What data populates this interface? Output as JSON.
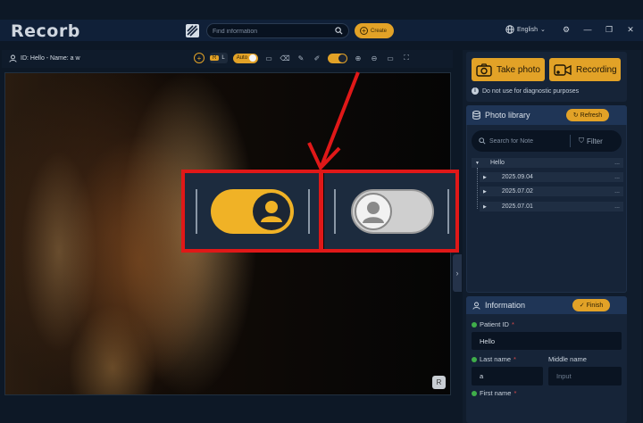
{
  "app": {
    "logo": "Recorb"
  },
  "titlebar": {
    "search_placeholder": "Find information",
    "create_label": "Create",
    "language": "English"
  },
  "viewer": {
    "patient_label": "ID: Hello - Name: a w",
    "seg_r": "R",
    "seg_l": "L",
    "auto_label": "Auto",
    "corner_badge": "R"
  },
  "capture": {
    "photo_label": "Take photo",
    "record_label": "Recording",
    "warning": "Do not use for diagnostic purposes"
  },
  "library": {
    "title": "Photo library",
    "refresh_label": "Refresh",
    "search_placeholder": "Search for Note",
    "filter_label": "Filter",
    "tree": [
      {
        "label": "Hello",
        "more": "..."
      },
      {
        "label": "2025.09.04",
        "more": "..."
      },
      {
        "label": "2025.07.02",
        "more": "..."
      },
      {
        "label": "2025.07.01",
        "more": "..."
      }
    ]
  },
  "information": {
    "title": "Information",
    "finish_label": "Finish",
    "patient_id_label": "Patient ID",
    "patient_id_value": "Hello",
    "last_name_label": "Last name",
    "last_name_value": "a",
    "middle_name_label": "Middle name",
    "middle_name_placeholder": "Input",
    "first_name_label": "First name",
    "required_mark": "*"
  },
  "colors": {
    "accent": "#e2a227",
    "callout": "#e01818",
    "panel": "#162438"
  }
}
